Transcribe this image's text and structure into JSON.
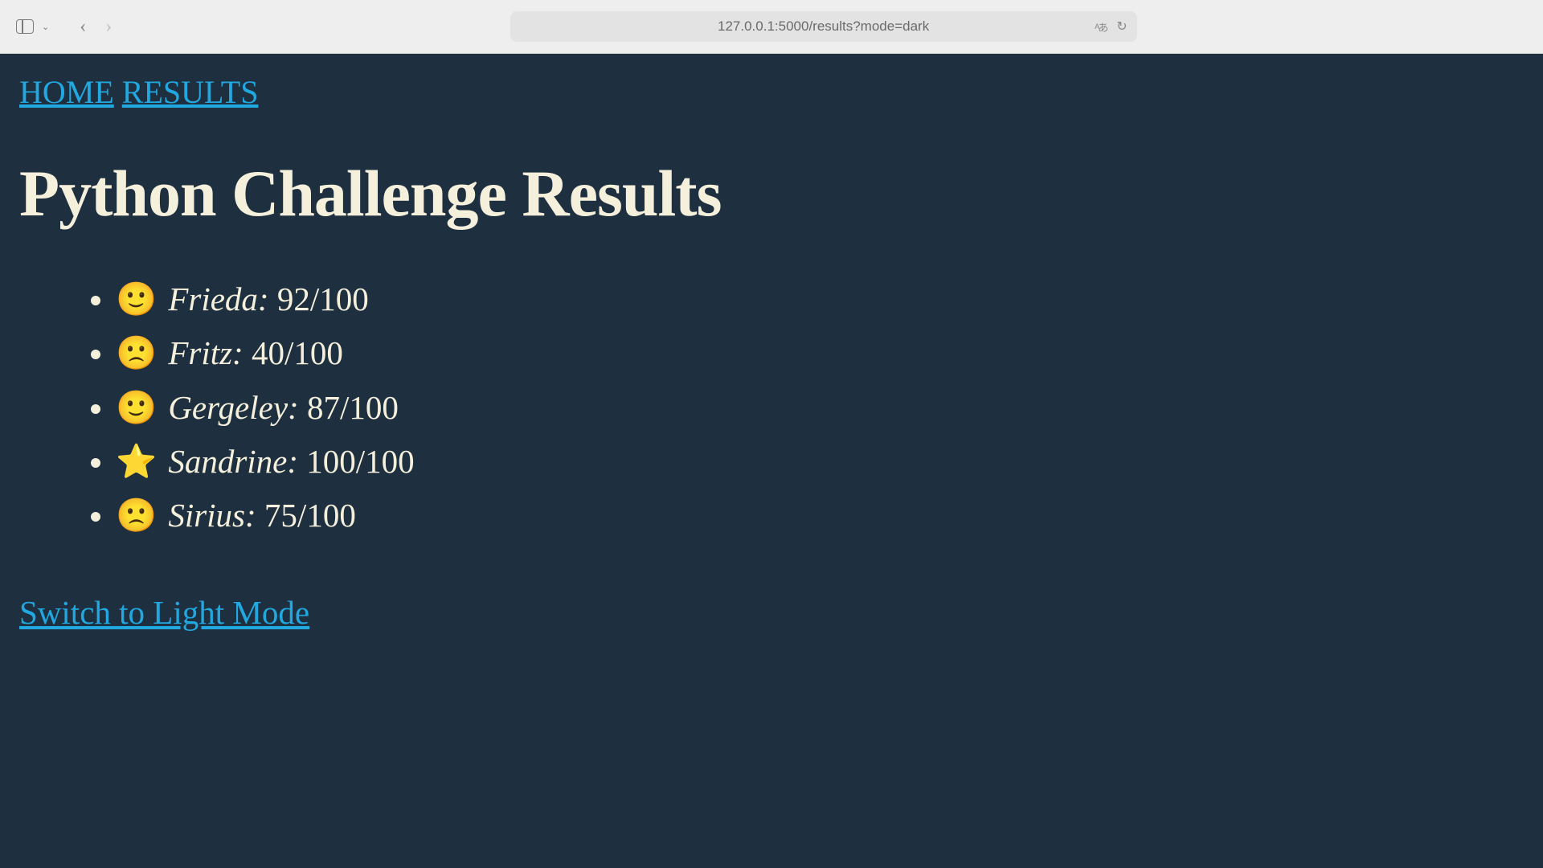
{
  "browser": {
    "url": "127.0.0.1:5000/results?mode=dark"
  },
  "nav": {
    "home": "HOME",
    "results": "RESULTS"
  },
  "page": {
    "title": "Python Challenge Results"
  },
  "results": [
    {
      "emoji": "🙂",
      "name": "Frieda:",
      "score": "92/100"
    },
    {
      "emoji": "🙁",
      "name": "Fritz:",
      "score": "40/100"
    },
    {
      "emoji": "🙂",
      "name": "Gergeley:",
      "score": "87/100"
    },
    {
      "emoji": "⭐",
      "name": "Sandrine:",
      "score": "100/100"
    },
    {
      "emoji": "🙁",
      "name": "Sirius:",
      "score": "75/100"
    }
  ],
  "modeLink": "Switch to Light Mode"
}
